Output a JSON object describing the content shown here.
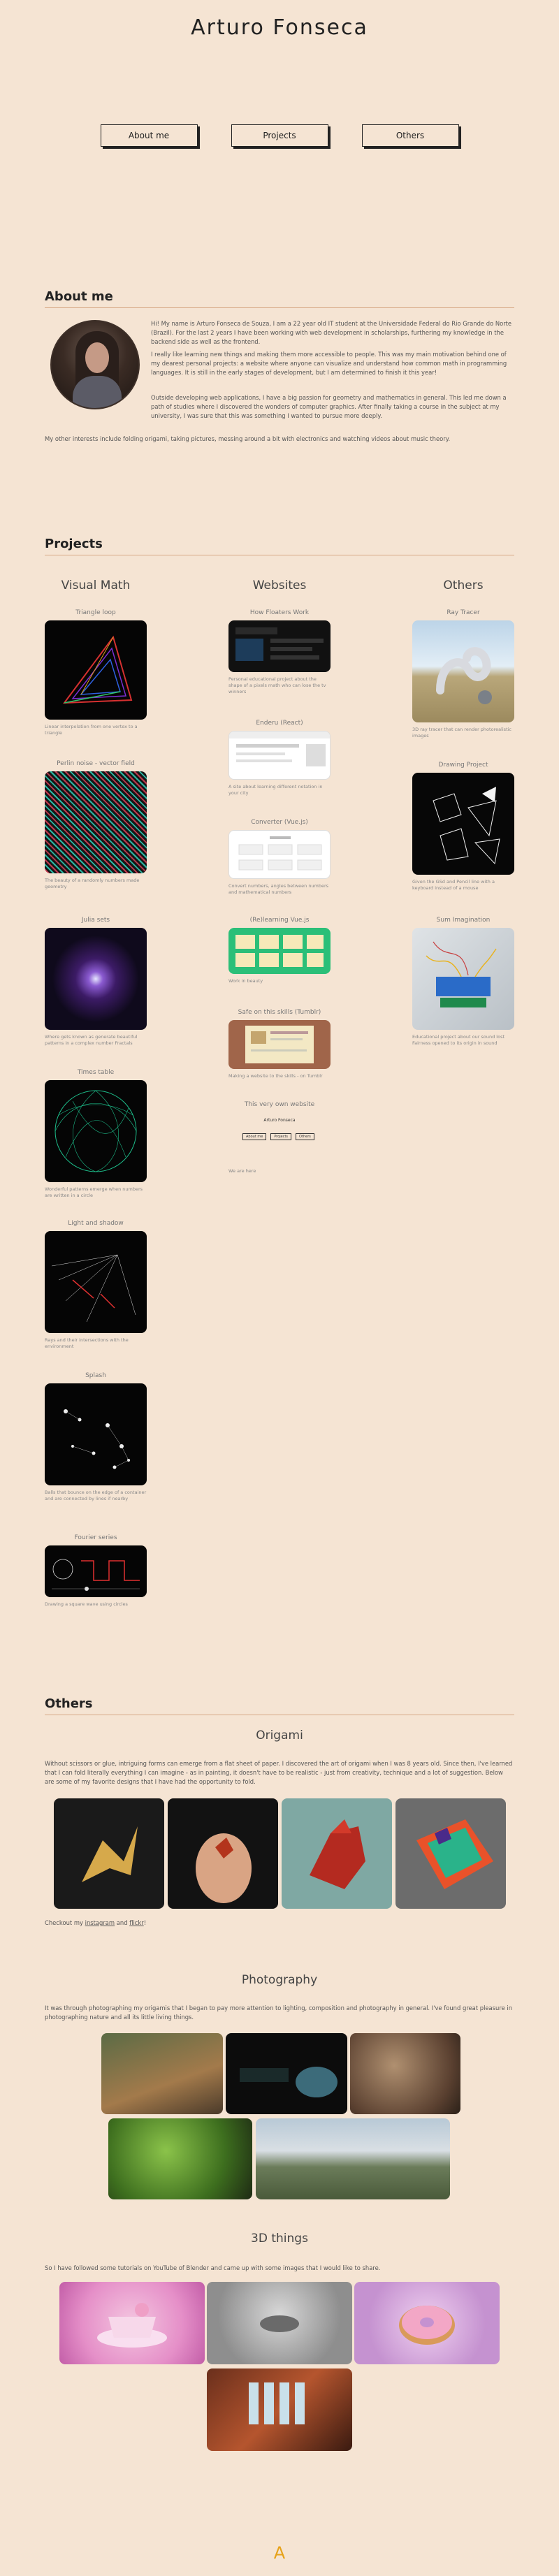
{
  "header": {
    "title": "Arturo Fonseca"
  },
  "nav": {
    "about": "About me",
    "projects": "Projects",
    "others": "Others"
  },
  "about": {
    "title": "About me",
    "p1": "Hi! My name is Arturo Fonseca de Souza, I am a 22 year old IT student at the Universidade Federal do Rio Grande do Norte (Brazil). For the last 2 years I have been working with web development in scholarships, furthering my knowledge in the backend side as well as the frontend.",
    "p2": "I really like learning new things and making them more accessible to people. This was my main motivation behind one of my dearest personal projects: a website where anyone can visualize and understand how common math in programming languages. It is still in the early stages of development, but I am determined to finish it this year!",
    "p3": "Outside developing web applications, I have a big passion for geometry and mathematics in general. This led me down a path of studies where I discovered the wonders of computer graphics. After finally taking a course in the subject at my university, I was sure that this was something I wanted to pursue more deeply.",
    "p4": "My other interests include folding origami, taking pictures, messing around a bit with electronics and watching videos about music theory."
  },
  "projects": {
    "title": "Projects",
    "columns": {
      "visual_math": "Visual Math",
      "websites": "Websites",
      "others": "Others"
    },
    "visual_math": [
      {
        "title": "Triangle loop",
        "caption": "Linear interpolation from one vertex to a triangle"
      },
      {
        "title": "Perlin noise - vector field",
        "caption": "The beauty of a randomly numbers made geometry"
      },
      {
        "title": "Julia sets",
        "caption": "Where gets known as generate beautiful patterns in a complex number Fractals"
      },
      {
        "title": "Times table",
        "caption": "Wonderful patterns emerge when numbers are written in a circle"
      },
      {
        "title": "Light and shadow",
        "caption": "Rays and their intersections with the environment"
      },
      {
        "title": "Splash",
        "caption": "Balls that bounce on the edge of a container and are connected by lines if nearby"
      },
      {
        "title": "Fourier series",
        "caption": "Drawing a square wave using circles"
      }
    ],
    "websites": [
      {
        "title": "How Floaters Work",
        "caption": "Personal educational project about the shape of a pixels math who can lose the tv winners"
      },
      {
        "title": "Enderu (React)",
        "caption": "A site about learning different notation in your city"
      },
      {
        "title": "Converter (Vue.js)",
        "caption": "Convert numbers, angles between numbers and mathematical numbers"
      },
      {
        "title": "(Re)learning Vue.js",
        "caption": "Work in beauty"
      },
      {
        "title": "Safe on this skills (Tumblr)",
        "caption": "Making a website to the skills - on Tumblr"
      },
      {
        "title": "This very own website",
        "caption": "We are here"
      }
    ],
    "others": [
      {
        "title": "Ray Tracer",
        "caption": "3D ray tracer that can render photorealistic images"
      },
      {
        "title": "Drawing Project",
        "caption": "Given the GSd and Pencil line with a keyboard instead of a mouse"
      },
      {
        "title": "Sum Imagination",
        "caption": "Educational project about our sound lost Fairness opened to its origin in sound"
      }
    ],
    "mini_site": {
      "name": "Arturo Fonseca",
      "links": [
        "About me",
        "Projects",
        "Others"
      ]
    }
  },
  "others": {
    "title": "Others",
    "origami": {
      "title": "Origami",
      "text": "Without scissors or glue, intriguing forms can emerge from a flat sheet of paper. I discovered the art of origami when I was 8 years old. Since then, I've learned that I can fold literally everything I can imagine - as in painting, it doesn't have to be realistic - just from creativity, technique and a lot of suggestion. Below are some of my favorite designs that I have had the opportunity to fold.",
      "footer_prefix": "Checkout my ",
      "link1": "instagram",
      "footer_mid": " and ",
      "link2": "flickr",
      "footer_suffix": "!"
    },
    "photography": {
      "title": "Photography",
      "text": "It was through photographing my origamis that I began to pay more attention to lighting, composition and photography in general. I've found great pleasure in photographing nature and all its little living things."
    },
    "three_d": {
      "title": "3D things",
      "text": "So I have followed some tutorials on YouTube of Blender and came up with some images that I would like to share."
    }
  },
  "footer": {
    "logo": "A"
  },
  "colors": {
    "background": "#f5e4d3",
    "accent": "#d7a986",
    "logo": "#e6a21a"
  }
}
